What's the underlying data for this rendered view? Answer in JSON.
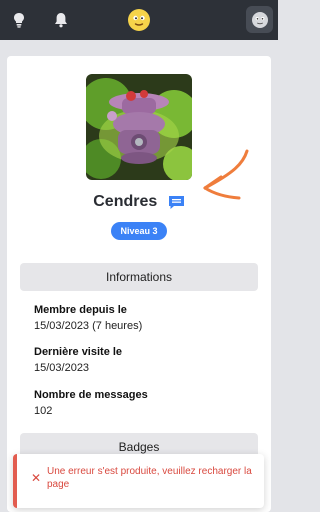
{
  "topbar": {
    "icons": [
      "lightbulb-icon",
      "bell-icon",
      "smiley-logo-icon",
      "user-avatar"
    ]
  },
  "profile": {
    "username": "Cendres",
    "level_badge": "Niveau 3"
  },
  "sections": {
    "informations_title": "Informations",
    "badges_title": "Badges"
  },
  "fields": [
    {
      "label": "Membre depuis le",
      "value": "15/03/2023 (7 heures)"
    },
    {
      "label": "Dernière visite le",
      "value": "15/03/2023"
    },
    {
      "label": "Nombre de messages",
      "value": "102"
    }
  ],
  "toast": {
    "message": "Une erreur s'est produite, veuillez recharger la page"
  },
  "colors": {
    "topbar": "#2d3138",
    "accent_blue": "#3b82f6",
    "error_red": "#d9493f",
    "arrow_orange": "#ef7d3c"
  }
}
